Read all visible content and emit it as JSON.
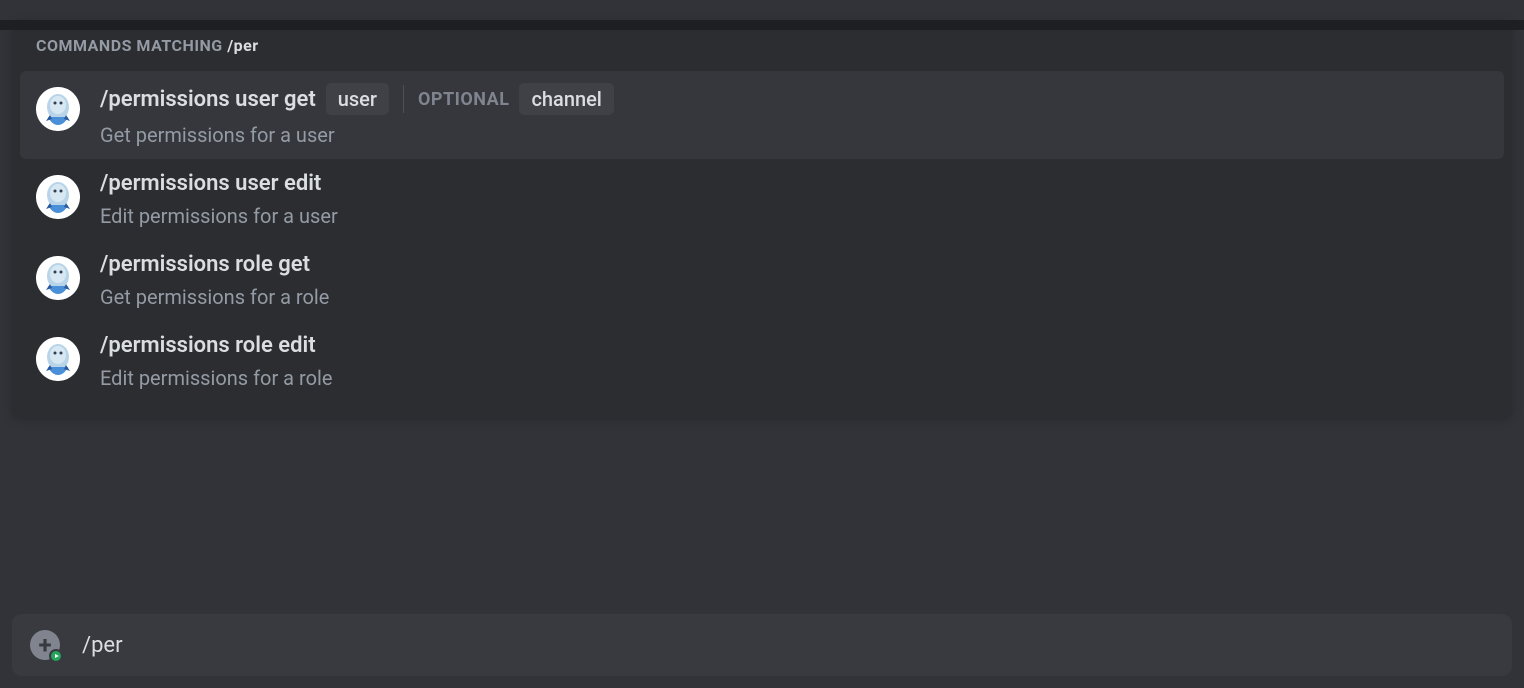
{
  "header": {
    "prefix": "COMMANDS MATCHING ",
    "query": "/per"
  },
  "commands": [
    {
      "name": "/permissions user get",
      "description": "Get permissions for a user",
      "selected": true,
      "required_params": [
        "user"
      ],
      "optional_label": "OPTIONAL",
      "optional_params": [
        "channel"
      ]
    },
    {
      "name": "/permissions user edit",
      "description": "Edit permissions for a user",
      "selected": false,
      "required_params": [],
      "optional_params": []
    },
    {
      "name": "/permissions role get",
      "description": "Get permissions for a role",
      "selected": false,
      "required_params": [],
      "optional_params": []
    },
    {
      "name": "/permissions role edit",
      "description": "Edit permissions for a role",
      "selected": false,
      "required_params": [],
      "optional_params": []
    }
  ],
  "input": {
    "value": "/per"
  }
}
